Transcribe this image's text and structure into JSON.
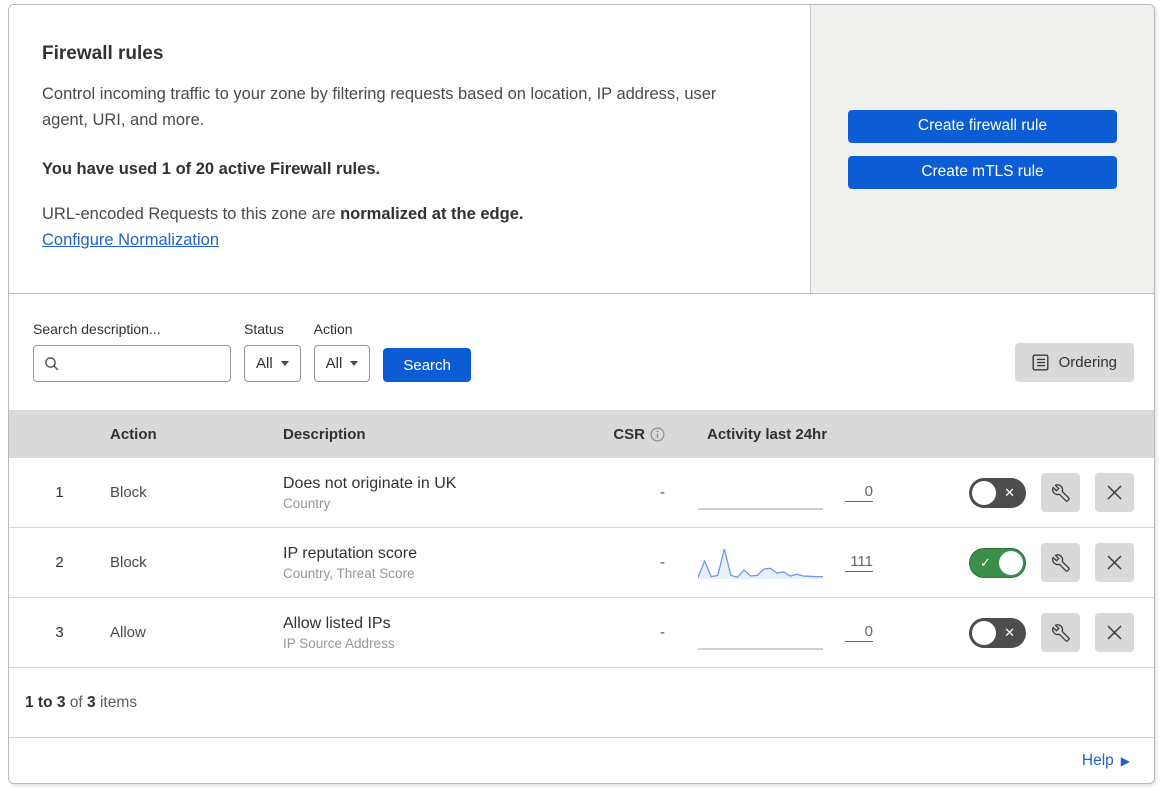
{
  "header": {
    "title": "Firewall rules",
    "description": "Control incoming traffic to your zone by filtering requests based on location, IP address, user agent, URI, and more.",
    "usage_bold": "You have used 1 of 20 active Firewall rules.",
    "normalization_prefix": "URL-encoded Requests to this zone are ",
    "normalization_bold": "normalized at the edge.",
    "normalization_link": "Configure Normalization",
    "create_firewall_button": "Create firewall rule",
    "create_mtls_button": "Create mTLS rule"
  },
  "filters": {
    "search_label": "Search description...",
    "search_value": "",
    "status_label": "Status",
    "status_value": "All",
    "action_label": "Action",
    "action_value": "All",
    "search_button": "Search",
    "ordering_button": "Ordering"
  },
  "table": {
    "columns": {
      "action": "Action",
      "description": "Description",
      "csr": "CSR",
      "activity": "Activity last 24hr"
    },
    "rows": [
      {
        "index": "1",
        "action": "Block",
        "description": "Does not originate in UK",
        "fields": "Country",
        "csr": "-",
        "activity_count": "0",
        "enabled": false,
        "sparkline": null
      },
      {
        "index": "2",
        "action": "Block",
        "description": "IP reputation score",
        "fields": "Country, Threat Score",
        "csr": "-",
        "activity_count": "111",
        "enabled": true,
        "sparkline": [
          0.05,
          0.6,
          0.08,
          0.12,
          1.0,
          0.12,
          0.06,
          0.3,
          0.1,
          0.12,
          0.33,
          0.36,
          0.2,
          0.24,
          0.1,
          0.16,
          0.1,
          0.09,
          0.08,
          0.08
        ]
      },
      {
        "index": "3",
        "action": "Allow",
        "description": "Allow listed IPs",
        "fields": "IP Source Address",
        "csr": "-",
        "activity_count": "0",
        "enabled": false,
        "sparkline": null
      }
    ]
  },
  "footer": {
    "range_bold": "1 to 3",
    "of_text": " of ",
    "total_bold": "3",
    "items_text": " items",
    "help_link": "Help"
  },
  "icons": {
    "check": "✓",
    "cross": "✕",
    "help_arrow": "▶"
  },
  "colors": {
    "primary_blue": "#0b5cd5",
    "link_blue": "#2262c9",
    "toggle_on_green": "#3e8e4b",
    "toggle_off_gray": "#4d4d4d",
    "header_gray": "#d9d9d9",
    "panel_gray": "#f0f0ef",
    "sparkline_blue": "#6b9ae0"
  }
}
